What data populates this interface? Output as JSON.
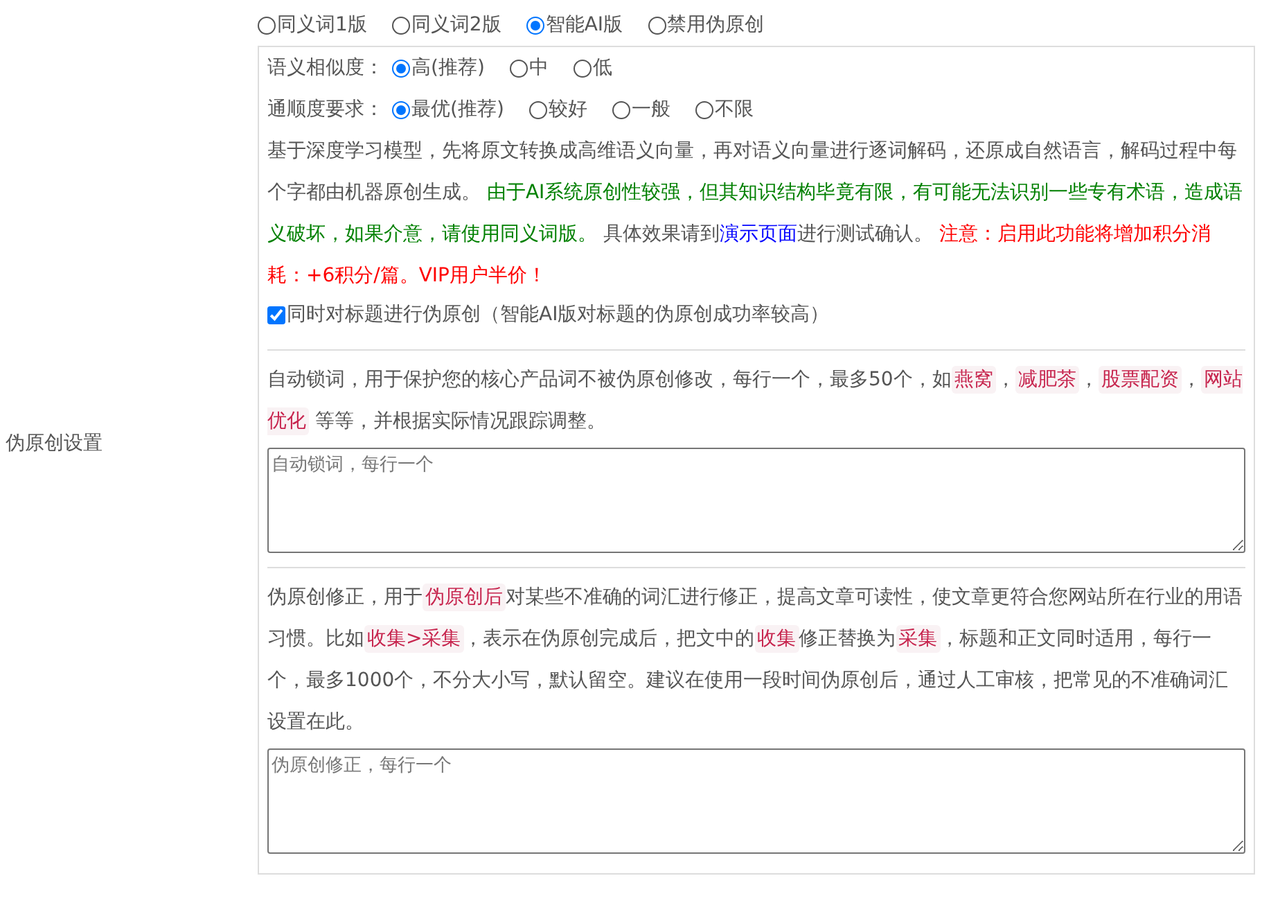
{
  "sidebar_label": "伪原创设置",
  "modes": [
    {
      "label": "同义词1版",
      "selected": false
    },
    {
      "label": "同义词2版",
      "selected": false
    },
    {
      "label": "智能AI版",
      "selected": true
    },
    {
      "label": "禁用伪原创",
      "selected": false
    }
  ],
  "similarity": {
    "label": "语义相似度：",
    "options": [
      {
        "label": "高(推荐)",
        "selected": true
      },
      {
        "label": "中",
        "selected": false
      },
      {
        "label": "低",
        "selected": false
      }
    ]
  },
  "fluency": {
    "label": "通顺度要求：",
    "options": [
      {
        "label": "最优(推荐)",
        "selected": true
      },
      {
        "label": "较好",
        "selected": false
      },
      {
        "label": "一般",
        "selected": false
      },
      {
        "label": "不限",
        "selected": false
      }
    ]
  },
  "description": [
    {
      "kind": "plain",
      "text": "基于深度学习模型，先将原文转换成高维语义向量，再对语义向量进行逐词解码，还原成自然语言，解码过程中每个字都由机器原创生成。 "
    },
    {
      "kind": "note",
      "text": "由于AI系统原创性较强，但其知识结构毕竟有限，有可能无法识别一些专有术语，造成语义破坏，如果介意，请使用同义词版。"
    },
    {
      "kind": "plain",
      "text": " 具体效果请到"
    },
    {
      "kind": "link",
      "text": "演示页面"
    },
    {
      "kind": "plain",
      "text": "进行测试确认。 "
    },
    {
      "kind": "warning",
      "text": "注意：启用此功能将增加积分消耗：+6积分/篇。VIP用户半价！"
    }
  ],
  "title_option": {
    "label": "同时对标题进行伪原创（智能AI版对标题的伪原创成功率较高）",
    "checked": true
  },
  "lock_words": {
    "description": [
      {
        "kind": "plain",
        "text": "自动锁词，用于保护您的核心产品词不被伪原创修改，每行一个，最多50个，如"
      },
      {
        "kind": "tag",
        "text": "燕窝"
      },
      {
        "kind": "plain",
        "text": "，"
      },
      {
        "kind": "tag",
        "text": "减肥茶"
      },
      {
        "kind": "plain",
        "text": "，"
      },
      {
        "kind": "tag",
        "text": "股票配资"
      },
      {
        "kind": "plain",
        "text": "，"
      },
      {
        "kind": "tag",
        "text": "网站优化"
      },
      {
        "kind": "plain",
        "text": " 等等，并根据实际情况跟踪调整。"
      }
    ],
    "placeholder": "自动锁词，每行一个"
  },
  "corrections": {
    "description": [
      {
        "kind": "plain",
        "text": "伪原创修正，用于"
      },
      {
        "kind": "tag",
        "text": "伪原创后"
      },
      {
        "kind": "plain",
        "text": "对某些不准确的词汇进行修正，提高文章可读性，使文章更符合您网站所在行业的用语习惯。比如"
      },
      {
        "kind": "tag",
        "text": "收集>采集"
      },
      {
        "kind": "plain",
        "text": "，表示在伪原创完成后，把文中的"
      },
      {
        "kind": "tag",
        "text": "收集"
      },
      {
        "kind": "plain",
        "text": "修正替换为"
      },
      {
        "kind": "tag",
        "text": "采集"
      },
      {
        "kind": "plain",
        "text": "，标题和正文同时适用，每行一个，最多1000个，不分大小写，默认留空。建议在使用一段时间伪原创后，通过人工审核，把常见的不准确词汇设置在此。"
      }
    ],
    "placeholder": "伪原创修正，每行一个"
  }
}
